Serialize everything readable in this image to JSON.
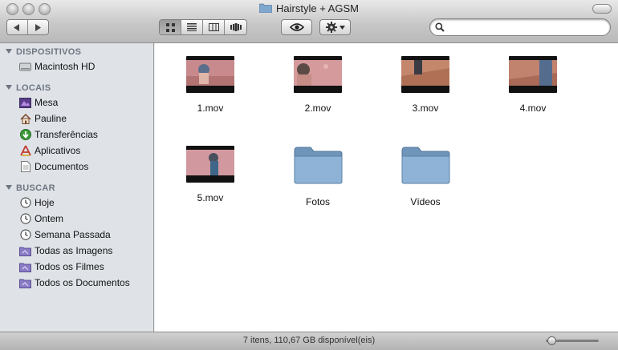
{
  "window": {
    "title": "Hairstyle + AGSM"
  },
  "search": {
    "placeholder": "",
    "value": ""
  },
  "sidebar": {
    "sections": [
      {
        "title": "DISPOSITIVOS",
        "items": [
          {
            "label": "Macintosh HD",
            "icon": "hard-drive-icon"
          }
        ]
      },
      {
        "title": "LOCAIS",
        "items": [
          {
            "label": "Mesa",
            "icon": "desktop-icon"
          },
          {
            "label": "Pauline",
            "icon": "home-icon"
          },
          {
            "label": "Transferências",
            "icon": "downloads-icon"
          },
          {
            "label": "Aplicativos",
            "icon": "applications-icon"
          },
          {
            "label": "Documentos",
            "icon": "documents-icon"
          }
        ]
      },
      {
        "title": "BUSCAR",
        "items": [
          {
            "label": "Hoje",
            "icon": "clock-icon"
          },
          {
            "label": "Ontem",
            "icon": "clock-icon"
          },
          {
            "label": "Semana Passada",
            "icon": "clock-icon"
          },
          {
            "label": "Todas as Imagens",
            "icon": "smart-folder-icon"
          },
          {
            "label": "Todos os Filmes",
            "icon": "smart-folder-icon"
          },
          {
            "label": "Todos os Documentos",
            "icon": "smart-folder-icon"
          }
        ]
      }
    ]
  },
  "files": [
    {
      "name": "1.mov",
      "kind": "movie"
    },
    {
      "name": "2.mov",
      "kind": "movie"
    },
    {
      "name": "3.mov",
      "kind": "movie"
    },
    {
      "name": "4.mov",
      "kind": "movie"
    },
    {
      "name": "5.mov",
      "kind": "movie"
    },
    {
      "name": "Fotos",
      "kind": "folder"
    },
    {
      "name": "Vídeos",
      "kind": "folder"
    }
  ],
  "status": {
    "text": "7 itens, 110,67 GB disponível(eis)"
  },
  "colors": {
    "folder": "#7fa6cc",
    "sidebar": "#dfe3e8",
    "section_header": "#6e7681"
  }
}
